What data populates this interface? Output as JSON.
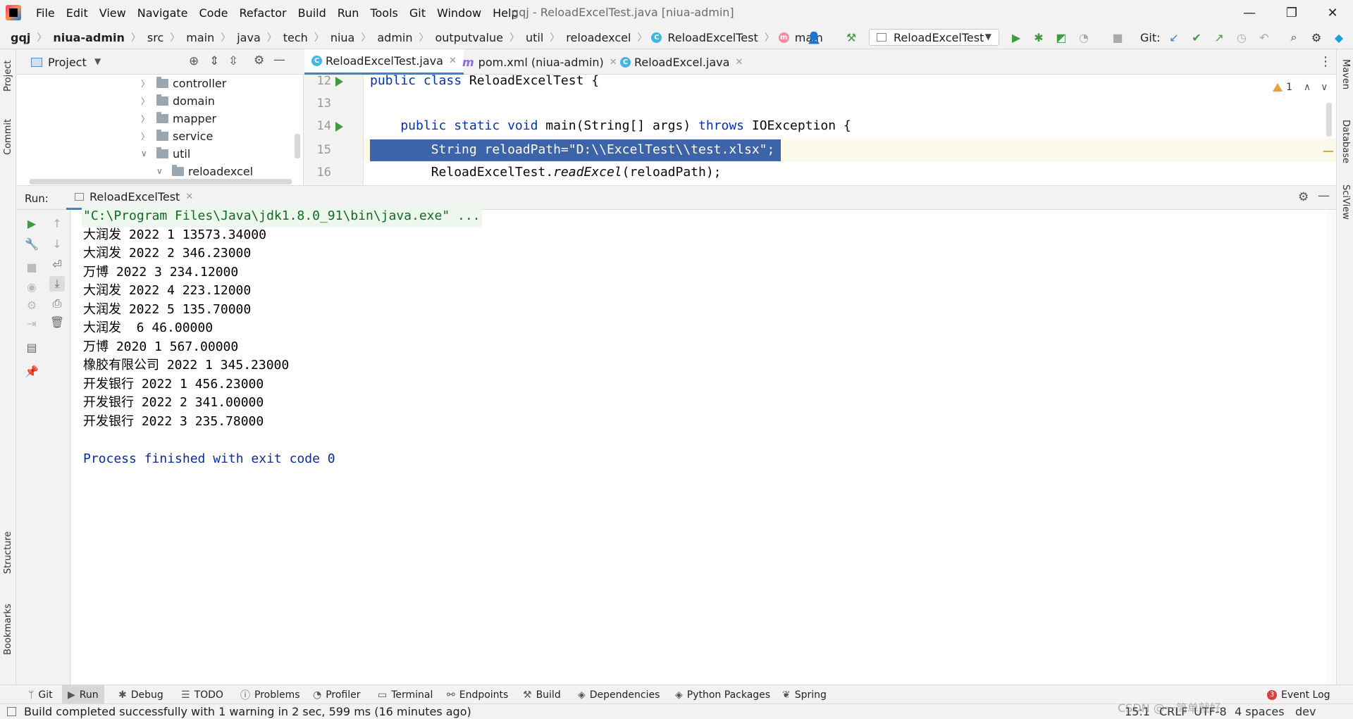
{
  "window": {
    "title": "gqj - ReloadExcelTest.java [niua-admin]",
    "minimize": "—",
    "maximize": "❐",
    "close": "✕"
  },
  "menu": [
    "File",
    "Edit",
    "View",
    "Navigate",
    "Code",
    "Refactor",
    "Build",
    "Run",
    "Tools",
    "Git",
    "Window",
    "Help"
  ],
  "breadcrumb": {
    "items": [
      "gqj",
      "niua-admin",
      "src",
      "main",
      "java",
      "tech",
      "niua",
      "admin",
      "outputvalue",
      "util",
      "reloadexcel",
      "ReloadExcelTest",
      "main"
    ]
  },
  "toolbar": {
    "run_config": "ReloadExcelTest",
    "git_label": "Git:"
  },
  "project": {
    "title": "Project",
    "tree": [
      "controller",
      "domain",
      "mapper",
      "service",
      "util",
      "reloadexcel"
    ]
  },
  "editor": {
    "tabs": [
      {
        "label": "ReloadExcelTest.java"
      },
      {
        "label": "pom.xml (niua-admin)"
      },
      {
        "label": "ReloadExcel.java"
      }
    ],
    "warning_count": "1",
    "lines": [
      {
        "num": "12",
        "segments": [
          {
            "t": "public class ",
            "c": "kw"
          },
          {
            "t": "ReloadExcelTest {",
            "c": ""
          }
        ]
      },
      {
        "num": "13",
        "segments": []
      },
      {
        "num": "14",
        "segments": [
          {
            "t": "    public static void ",
            "c": "kw"
          },
          {
            "t": "main(String[] args) ",
            "c": ""
          },
          {
            "t": "throws ",
            "c": "kw"
          },
          {
            "t": "IOException {",
            "c": ""
          }
        ]
      },
      {
        "num": "15",
        "segments": [
          {
            "t": "        String reloadPath=\"D:\\\\ExcelTest\\\\test.xlsx\";",
            "c": "sel"
          }
        ]
      },
      {
        "num": "16",
        "segments": [
          {
            "t": "        ReloadExcelTest.",
            "c": ""
          },
          {
            "t": "readExcel",
            "c": "it"
          },
          {
            "t": "(reloadPath);",
            "c": ""
          }
        ]
      }
    ]
  },
  "run": {
    "label": "Run:",
    "tab": "ReloadExcelTest",
    "console": [
      "\"C:\\Program Files\\Java\\jdk1.8.0_91\\bin\\java.exe\" ...",
      "大润发 2022 1 13573.34000",
      "大润发 2022 2 346.23000",
      "万博 2022 3 234.12000",
      "大润发 2022 4 223.12000",
      "大润发 2022 5 135.70000",
      "大润发  6 46.00000",
      "万博 2020 1 567.00000",
      "橡胶有限公司 2022 1 345.23000",
      "开发银行 2022 1 456.23000",
      "开发银行 2022 2 341.00000",
      "开发银行 2022 3 235.78000",
      "",
      "Process finished with exit code 0"
    ]
  },
  "left_strip": [
    "Project",
    "Commit",
    "Structure",
    "Bookmarks"
  ],
  "right_strip": [
    "Maven",
    "Database",
    "SciView"
  ],
  "bottom_tabs": [
    "Git",
    "Run",
    "Debug",
    "TODO",
    "Problems",
    "Profiler",
    "Terminal",
    "Endpoints",
    "Build",
    "Dependencies",
    "Python Packages",
    "Spring"
  ],
  "event_log": {
    "count": "3",
    "label": "Event Log"
  },
  "status": {
    "message": "Build completed successfully with 1 warning in 2 sec, 599 ms (16 minutes ago)",
    "position": "15:1",
    "line_sep": "CRLF",
    "encoding": "UTF-8",
    "indent": "4 spaces",
    "branch": "dev"
  },
  "watermark": "CSDN @一简单就好"
}
